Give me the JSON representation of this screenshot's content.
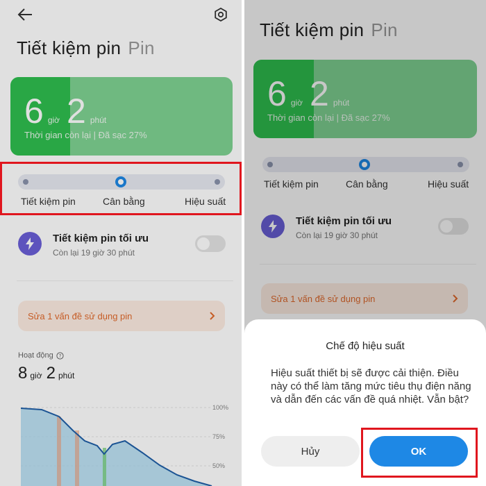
{
  "screen": {
    "title": "Tiết kiệm pin",
    "subtitle": "Pin",
    "battery": {
      "hours": "6",
      "hours_unit": "giờ",
      "minutes": "2",
      "minutes_unit": "phút",
      "remaining_text": "Thời gian còn lại | Đã sạc 27%",
      "charge_fraction": 0.27
    },
    "modes": [
      "Tiết kiệm pin",
      "Cân bằng",
      "Hiệu suất"
    ],
    "selected_mode_index": 1,
    "optimized": {
      "title": "Tiết kiệm pin tối ưu",
      "subtitle": "Còn lại 19 giờ 30 phút",
      "enabled": false
    },
    "issue_text": "Sửa 1 vấn đề sử dụng pin",
    "activity": {
      "label": "Hoạt động",
      "hours": "8",
      "hours_unit": "giờ",
      "minutes": "2",
      "minutes_unit": "phút",
      "grid_labels": [
        "100%",
        "75%",
        "50%"
      ]
    }
  },
  "dialog": {
    "title": "Chế độ hiệu suất",
    "body": "Hiệu suất thiết bị sẽ được cải thiện. Điều này có thể làm tăng mức tiêu thụ điện năng và dẫn đến các vấn đề quá nhiệt. Vẫn bật?",
    "cancel_label": "Hủy",
    "ok_label": "OK"
  },
  "colors": {
    "accent": "#1e88e5",
    "battery_fill": "#2fbf4f",
    "highlight": "#e0161e",
    "issue_text": "#e26a2c",
    "chart_fill": "#a8d8f0",
    "chart_line": "#1f5fa8"
  }
}
